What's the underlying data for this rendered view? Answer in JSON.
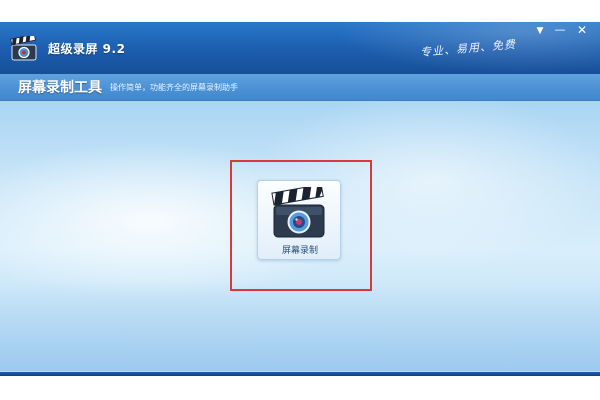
{
  "window": {
    "title": "超级录屏 9.2",
    "slogan": "专业、易用、免费",
    "controls": {
      "menu": "▼",
      "minimize": "—",
      "close": "✕"
    }
  },
  "subheader": {
    "title": "屏幕录制工具",
    "description": "操作简单，功能齐全的屏幕录制助手"
  },
  "main": {
    "tool_button_label": "屏幕录制"
  },
  "colors": {
    "titlebar": "#1d5fb0",
    "subheader": "#4a90d4",
    "content_bg": "#c8e5f8",
    "highlight_border": "#d63a3a"
  },
  "icons": {
    "app": "clapperboard-camera-icon",
    "tool": "clapperboard-camera-icon"
  }
}
